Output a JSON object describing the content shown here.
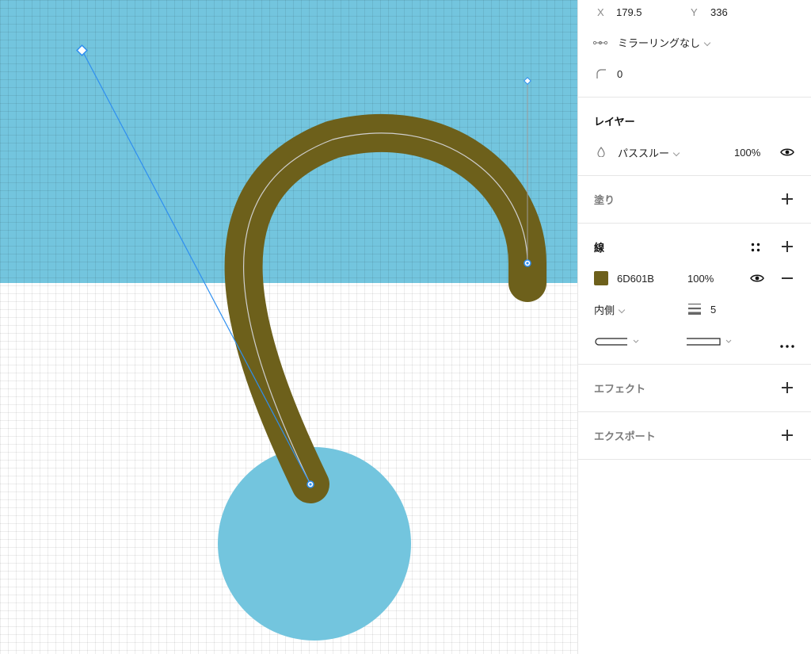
{
  "properties": {
    "x_label": "X",
    "x_value": "179.5",
    "y_label": "Y",
    "y_value": "336",
    "mirroring": "ミラーリングなし",
    "corner_radius": "0"
  },
  "layer": {
    "title": "レイヤー",
    "blend_mode": "パススルー",
    "opacity": "100%"
  },
  "fill": {
    "title": "塗り"
  },
  "stroke": {
    "title": "線",
    "color_hex": "6D601B",
    "opacity": "100%",
    "position": "内側",
    "weight": "5"
  },
  "effects": {
    "title": "エフェクト"
  },
  "export": {
    "title": "エクスポート"
  },
  "colors": {
    "canvas_blue": "#73c5de",
    "stroke_color": "#6d601b",
    "selection_blue": "#2f8ff0"
  },
  "icons": [
    "mirroring-icon",
    "corner-radius-icon",
    "blend-drop-icon",
    "eye-icon",
    "style-dots-icon",
    "plus-icon",
    "minus-icon",
    "stroke-weight-icon",
    "more-icon"
  ]
}
